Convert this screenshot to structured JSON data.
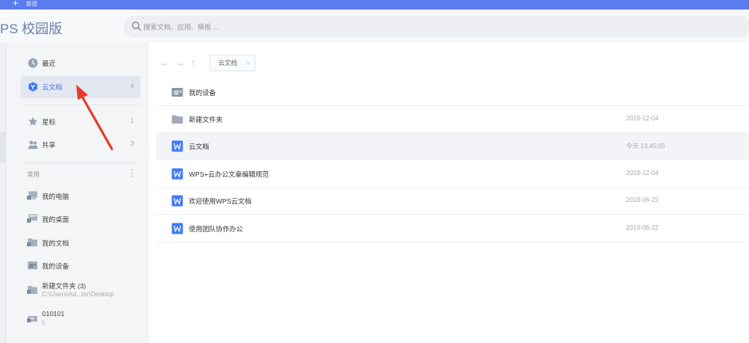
{
  "topbar": {
    "new_label": "新建"
  },
  "header": {
    "brand": "PS 校园版",
    "search_placeholder": "搜索文档、应用、模板 ..."
  },
  "sidebar": {
    "nav": [
      {
        "label": "最近",
        "count": "",
        "icon": "clock-icon"
      },
      {
        "label": "云文档",
        "count": "4",
        "icon": "cloud-doc-icon"
      },
      {
        "label": "星标",
        "count": "1",
        "icon": "star-icon"
      },
      {
        "label": "共享",
        "count": "3",
        "icon": "share-icon"
      }
    ],
    "section_label": "常用",
    "favorites": [
      {
        "label": "我的电脑",
        "sub": "",
        "icon": "computer-icon"
      },
      {
        "label": "我的桌面",
        "sub": "",
        "icon": "desktop-icon"
      },
      {
        "label": "我的文档",
        "sub": "",
        "icon": "documents-icon"
      },
      {
        "label": "我的设备",
        "sub": "",
        "icon": "device-icon"
      },
      {
        "label": "新建文件夹 (3)",
        "sub": "C:\\Users\\Ad...tor\\Desktop",
        "icon": "folder-shortcut-icon"
      },
      {
        "label": "010101",
        "sub": "I:",
        "icon": "drive-icon"
      }
    ]
  },
  "main": {
    "breadcrumb": "云文档",
    "files": [
      {
        "name": "我的设备",
        "date": "",
        "type": "device"
      },
      {
        "name": "新建文件夹",
        "date": "2019-12-04",
        "type": "folder"
      },
      {
        "name": "云文档",
        "date": "今天 13:45:55",
        "type": "word"
      },
      {
        "name": "WPS+云办公文章编辑规范",
        "date": "2019-12-04",
        "type": "word"
      },
      {
        "name": "欢迎使用WPS云文档",
        "date": "2019-06-22",
        "type": "word"
      },
      {
        "name": "使用团队协作办公",
        "date": "2019-06-22",
        "type": "word"
      }
    ]
  },
  "colors": {
    "accent": "#5b7cf0",
    "word_blue": "#3f7bf5",
    "annotation_red": "#e8392b"
  }
}
